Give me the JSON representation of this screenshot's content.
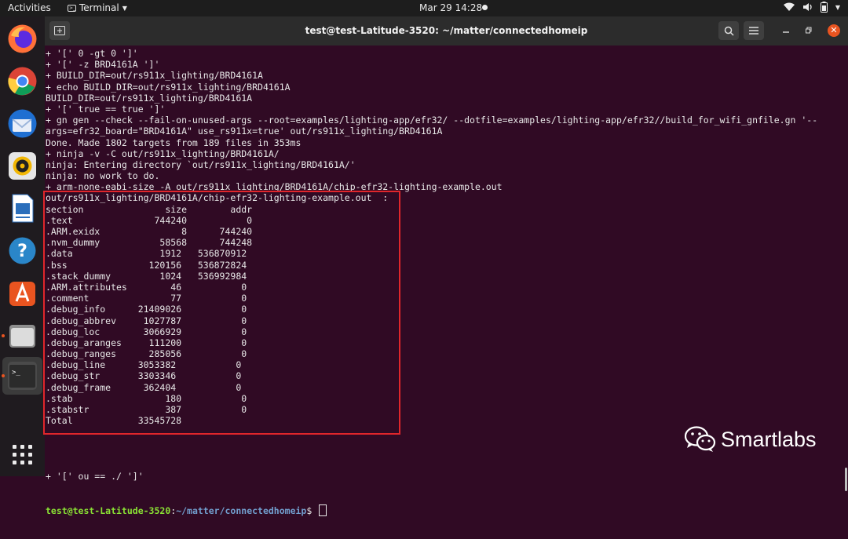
{
  "topbar": {
    "activities": "Activities",
    "app_name": "Terminal",
    "clock": "Mar 29  14:28"
  },
  "window": {
    "title": "test@test-Latitude-3520: ~/matter/connectedhomeip"
  },
  "terminal": {
    "lines": [
      "+ '[' 0 -gt 0 ']'",
      "+ '[' -z BRD4161A ']'",
      "+ BUILD_DIR=out/rs911x_lighting/BRD4161A",
      "+ echo BUILD_DIR=out/rs911x_lighting/BRD4161A",
      "BUILD_DIR=out/rs911x_lighting/BRD4161A",
      "+ '[' true == true ']'",
      "+ gn gen --check --fail-on-unused-args --root=examples/lighting-app/efr32/ --dotfile=examples/lighting-app/efr32//build_for_wifi_gnfile.gn '--",
      "args=efr32_board=\"BRD4161A\" use_rs911x=true' out/rs911x_lighting/BRD4161A",
      "Done. Made 1802 targets from 189 files in 353ms",
      "+ ninja -v -C out/rs911x_lighting/BRD4161A/",
      "ninja: Entering directory `out/rs911x_lighting/BRD4161A/'",
      "ninja: no work to do.",
      "+ arm-none-eabi-size -A out/rs911x_lighting/BRD4161A/chip-efr32-lighting-example.out",
      "out/rs911x_lighting/BRD4161A/chip-efr32-lighting-example.out  :",
      "section               size        addr",
      ".text               744240           0",
      ".ARM.exidx               8      744240",
      ".nvm_dummy           58568      744248",
      ".data                1912   536870912",
      ".bss               120156   536872824",
      ".stack_dummy         1024   536992984",
      ".ARM.attributes        46           0",
      ".comment               77           0",
      ".debug_info      21409026           0",
      ".debug_abbrev     1027787           0",
      ".debug_loc        3066929           0",
      ".debug_aranges     111200           0",
      ".debug_ranges      285056           0",
      ".debug_line      3053382           0",
      ".debug_str       3303346           0",
      ".debug_frame      362404           0",
      ".stab                 180           0",
      ".stabstr              387           0",
      "Total            33545728"
    ],
    "bottom_line": "+ '[' ou == ./ ']'",
    "prompt_user": "test@test-Latitude-3520",
    "prompt_colon": ":",
    "prompt_path": "~/matter/connectedhomeip",
    "prompt_symbol": "$ "
  },
  "watermark": {
    "text": "Smartlabs"
  },
  "dock": {
    "apps": [
      "firefox-icon",
      "chrome-icon",
      "thunderbird-icon",
      "rhythmbox-icon",
      "libreoffice-writer-icon",
      "help-icon",
      "software-center-icon",
      "files-icon",
      "terminal-icon",
      "show-applications-icon"
    ]
  },
  "colors": {
    "terminal_bg": "#300a24",
    "highlight": "#e0262b",
    "prompt_user": "#8ae234",
    "prompt_path": "#729fcf"
  }
}
